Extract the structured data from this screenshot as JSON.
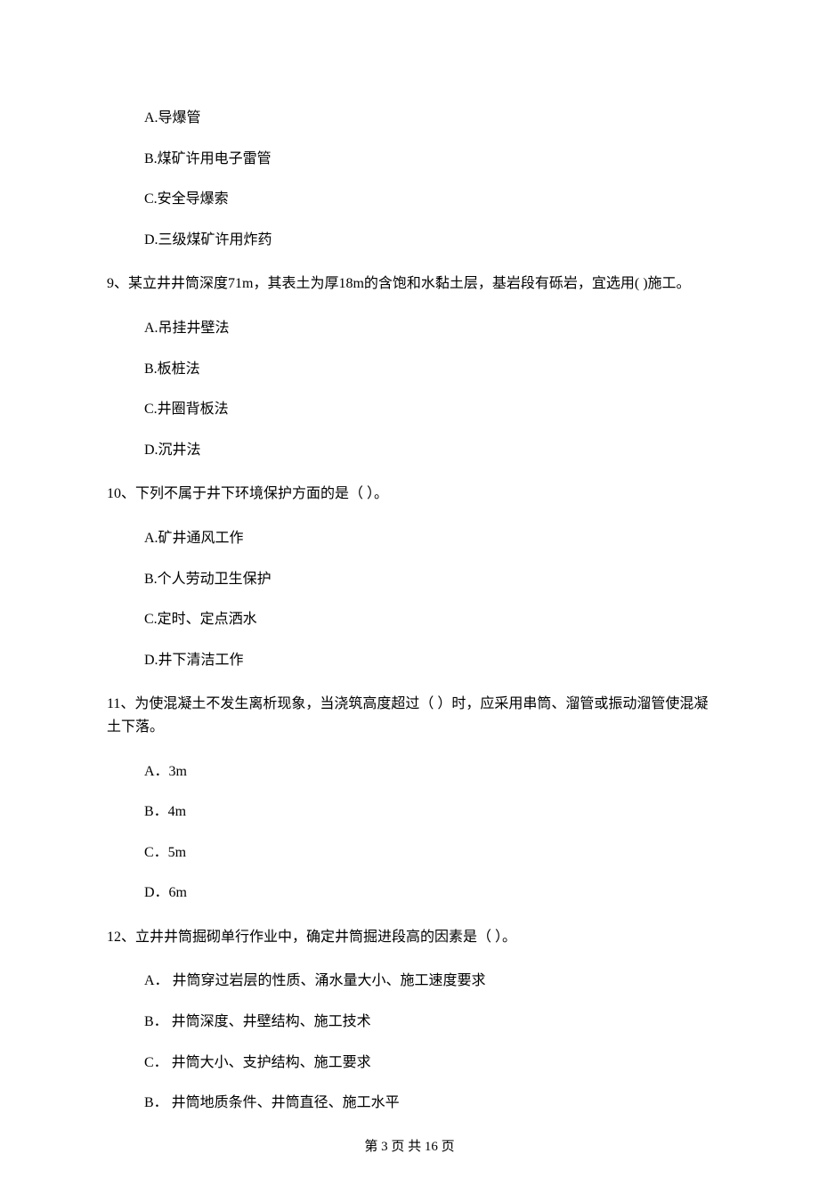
{
  "q8_options": {
    "a": "A.导爆管",
    "b": "B.煤矿许用电子雷管",
    "c": "C.安全导爆索",
    "d": "D.三级煤矿许用炸药"
  },
  "q9": {
    "stem": "9、某立井井筒深度71m，其表土为厚18m的含饱和水黏土层，基岩段有砾岩，宜选用(  )施工。",
    "a": "A.吊挂井壁法",
    "b": "B.板桩法",
    "c": "C.井圈背板法",
    "d": "D.沉井法"
  },
  "q10": {
    "stem": "10、下列不属于井下环境保护方面的是（    ）。",
    "a": "A.矿井通风工作",
    "b": "B.个人劳动卫生保护",
    "c": "C.定时、定点洒水",
    "d": "D.井下清洁工作"
  },
  "q11": {
    "stem": "11、为使混凝土不发生离析现象，当浇筑高度超过（    ）时，应采用串筒、溜管或振动溜管使混凝土下落。",
    "a": "A．3m",
    "b": "B．4m",
    "c": "C．5m",
    "d": "D．6m"
  },
  "q12": {
    "stem": "12、立井井筒掘砌单行作业中，确定井筒掘进段高的因素是（    ）。",
    "a": "A． 井筒穿过岩层的性质、涌水量大小、施工速度要求",
    "b": "B． 井筒深度、井壁结构、施工技术",
    "c": "C． 井筒大小、支护结构、施工要求",
    "d": "B． 井筒地质条件、井筒直径、施工水平"
  },
  "footer": "第 3 页 共 16 页"
}
